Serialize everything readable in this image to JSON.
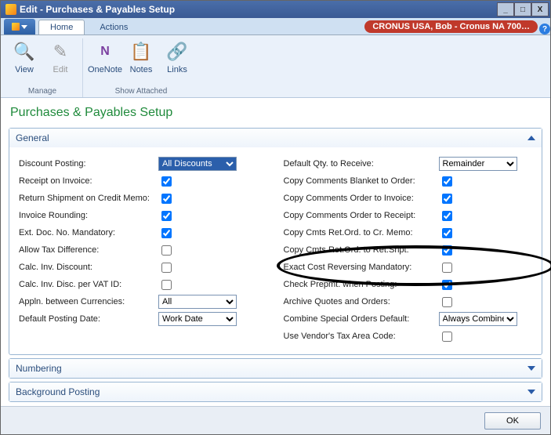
{
  "window": {
    "title": "Edit - Purchases & Payables Setup"
  },
  "tabs": {
    "home": "Home",
    "actions": "Actions"
  },
  "context_badge": "CRONUS USA, Bob - Cronus NA 700…",
  "ribbon": {
    "group_manage": "Manage",
    "group_show": "Show Attached",
    "view": "View",
    "edit": "Edit",
    "onenote": "OneNote",
    "notes": "Notes",
    "links": "Links"
  },
  "page_title": "Purchases & Payables Setup",
  "fasttabs": {
    "general": "General",
    "numbering": "Numbering",
    "background": "Background Posting"
  },
  "general": {
    "left": {
      "discount_posting": {
        "label": "Discount Posting:",
        "value": "All Discounts"
      },
      "receipt_on_invoice": {
        "label": "Receipt on Invoice:",
        "checked": true
      },
      "return_shipment_on_cm": {
        "label": "Return Shipment on Credit Memo:",
        "checked": true
      },
      "invoice_rounding": {
        "label": "Invoice Rounding:",
        "checked": true
      },
      "ext_doc_no_mandatory": {
        "label": "Ext. Doc. No. Mandatory:",
        "checked": true
      },
      "allow_tax_difference": {
        "label": "Allow Tax Difference:",
        "checked": false
      },
      "calc_inv_discount": {
        "label": "Calc. Inv. Discount:",
        "checked": false
      },
      "calc_inv_disc_per_vat": {
        "label": "Calc. Inv. Disc. per VAT ID:",
        "checked": false
      },
      "appln_between_currencies": {
        "label": "Appln. between Currencies:",
        "value": "All"
      },
      "default_posting_date": {
        "label": "Default Posting Date:",
        "value": "Work Date"
      }
    },
    "right": {
      "default_qty_to_receive": {
        "label": "Default Qty. to Receive:",
        "value": "Remainder"
      },
      "copy_cmts_blanket_order": {
        "label": "Copy Comments Blanket to Order:",
        "checked": true
      },
      "copy_cmts_order_invoice": {
        "label": "Copy Comments Order to Invoice:",
        "checked": true
      },
      "copy_cmts_order_receipt": {
        "label": "Copy Comments Order to Receipt:",
        "checked": true
      },
      "copy_cmts_retord_crmemo": {
        "label": "Copy Cmts Ret.Ord. to Cr. Memo:",
        "checked": true
      },
      "copy_cmts_retord_retshpt": {
        "label": "Copy Cmts Ret.Ord. to Ret.Shpt:",
        "checked": true
      },
      "exact_cost_reversing": {
        "label": "Exact Cost Reversing Mandatory:",
        "checked": false
      },
      "check_prepmt_posting": {
        "label": "Check Prepmt. when Posting:",
        "checked": true
      },
      "archive_quotes_orders": {
        "label": "Archive Quotes and Orders:",
        "checked": false
      },
      "combine_special_orders": {
        "label": "Combine Special Orders Default:",
        "value": "Always Combine"
      },
      "use_vendor_tax_area": {
        "label": "Use Vendor's Tax Area Code:",
        "checked": false
      }
    }
  },
  "buttons": {
    "ok": "OK"
  }
}
